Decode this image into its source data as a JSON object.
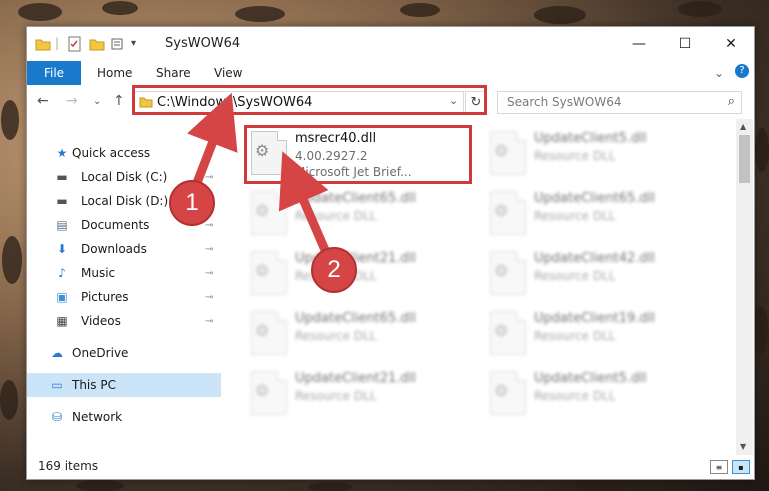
{
  "window": {
    "title": "SysWOW64",
    "minimize": "—",
    "maximize": "☐",
    "close": "✕"
  },
  "ribbon": {
    "tabs": [
      "File",
      "Home",
      "Share",
      "View"
    ],
    "expand": "⌄",
    "help": "?"
  },
  "nav": {
    "back": "←",
    "forward": "→",
    "recent": "⌄",
    "up": "↑",
    "path": "C:\\Windows\\SysWOW64",
    "refresh": "↻",
    "search_placeholder": "Search SysWOW64"
  },
  "sidebar": {
    "items": [
      {
        "label": "Quick access",
        "icon": "star-icon",
        "glyph": "★",
        "color": "#2b79d0",
        "pinned": false
      },
      {
        "label": "Local Disk (C:)",
        "icon": "drive-icon",
        "glyph": "▬",
        "color": "#555555",
        "pinned": true
      },
      {
        "label": "Local Disk (D:)",
        "icon": "drive-icon",
        "glyph": "▬",
        "color": "#555555",
        "pinned": true
      },
      {
        "label": "Documents",
        "icon": "documents-icon",
        "glyph": "▤",
        "color": "#5a6f8a",
        "pinned": true
      },
      {
        "label": "Downloads",
        "icon": "downloads-icon",
        "glyph": "⬇",
        "color": "#2b79d0",
        "pinned": true
      },
      {
        "label": "Music",
        "icon": "music-icon",
        "glyph": "♪",
        "color": "#2b79d0",
        "pinned": true
      },
      {
        "label": "Pictures",
        "icon": "pictures-icon",
        "glyph": "▣",
        "color": "#3d8fd6",
        "pinned": true
      },
      {
        "label": "Videos",
        "icon": "videos-icon",
        "glyph": "▦",
        "color": "#444444",
        "pinned": true
      },
      {
        "label": "OneDrive",
        "icon": "cloud-icon",
        "glyph": "☁",
        "color": "#2b79d0",
        "pinned": false
      },
      {
        "label": "This PC",
        "icon": "computer-icon",
        "glyph": "▭",
        "color": "#2b79d0",
        "pinned": false,
        "selected": true
      },
      {
        "label": "Network",
        "icon": "network-icon",
        "glyph": "⛁",
        "color": "#2b79d0",
        "pinned": false
      }
    ],
    "pin_glyph": "📌"
  },
  "files": [
    {
      "name": "msrecr40.dll",
      "line1": "4.00.2927.2",
      "line2": "Microsoft Jet Brief...",
      "highlighted": true
    },
    {
      "name": "UpdateClient5.dll",
      "line1": "Resource DLL",
      "line2": ""
    },
    {
      "name": "UpdateClient65.dll",
      "line1": "Resource DLL",
      "line2": ""
    },
    {
      "name": "UpdateClient65.dll",
      "line1": "Resource DLL",
      "line2": ""
    },
    {
      "name": "UpdateClient21.dll",
      "line1": "Resource DLL",
      "line2": ""
    },
    {
      "name": "UpdateClient42.dll",
      "line1": "Resource DLL",
      "line2": ""
    },
    {
      "name": "UpdateClient65.dll",
      "line1": "Resource DLL",
      "line2": ""
    },
    {
      "name": "UpdateClient19.dll",
      "line1": "Resource DLL",
      "line2": ""
    },
    {
      "name": "UpdateClient21.dll",
      "line1": "Resource DLL",
      "line2": ""
    },
    {
      "name": "UpdateClient5.dll",
      "line1": "Resource DLL",
      "line2": ""
    }
  ],
  "status": {
    "count": "169 items"
  },
  "annotations": {
    "step1": "1",
    "step2": "2",
    "color": "#d13a3a"
  }
}
